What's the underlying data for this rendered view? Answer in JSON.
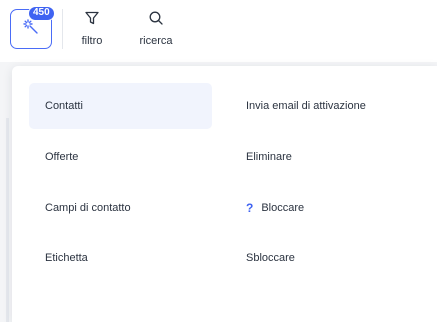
{
  "toolbar": {
    "badge_count": "450",
    "filter_label": "filtro",
    "search_label": "ricerca",
    "accent_color": "#3f63f2"
  },
  "menu": {
    "left": [
      {
        "label": "Contatti",
        "active": true
      },
      {
        "label": "Offerte"
      },
      {
        "label": "Campi di contatto"
      },
      {
        "label": "Etichetta"
      }
    ],
    "right": [
      {
        "label": "Invia email di attivazione"
      },
      {
        "label": "Eliminare"
      },
      {
        "label": "Bloccare",
        "icon": "question-icon",
        "icon_glyph": "?"
      },
      {
        "label": "Sbloccare"
      }
    ]
  }
}
